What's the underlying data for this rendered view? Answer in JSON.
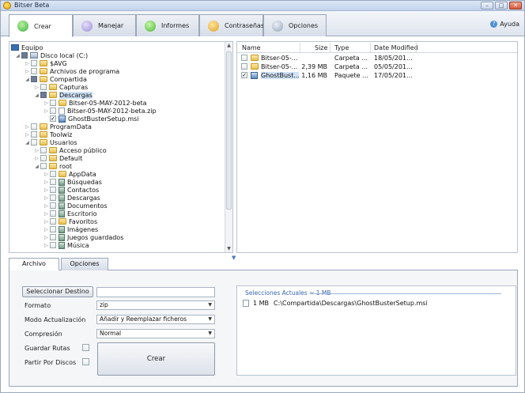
{
  "app": {
    "title": "Bitser Beta"
  },
  "window_controls": {
    "minimize": "–",
    "restore": "□",
    "close": "✕"
  },
  "tabs": [
    {
      "label": "Crear",
      "icon": "create-icon",
      "color": "#3cb043"
    },
    {
      "label": "Manejar",
      "icon": "manage-icon",
      "color": "#9a8fd8"
    },
    {
      "label": "Informes",
      "icon": "reports-icon",
      "color": "#46b83a"
    },
    {
      "label": "Contraseñas",
      "icon": "passwords-icon",
      "color": "#e0a020"
    },
    {
      "label": "Opciones",
      "icon": "options-icon",
      "color": "#8fa0b8"
    }
  ],
  "help": {
    "label": "Ayuda",
    "icon": "help-icon"
  },
  "tree": [
    {
      "label": "Equipo",
      "icon": "computer-icon",
      "arrow": "",
      "check": "none"
    },
    {
      "label": "Disco local (C:)",
      "icon": "drive-icon",
      "arrow": "◢",
      "check": "part"
    },
    {
      "label": "$AVG",
      "icon": "folder-icon",
      "arrow": "▷",
      "check": "off"
    },
    {
      "label": "Archivos de programa",
      "icon": "folder-icon",
      "arrow": "▷",
      "check": "off"
    },
    {
      "label": "Compartida",
      "icon": "folder-icon",
      "arrow": "◢",
      "check": "part"
    },
    {
      "label": "Capturas",
      "icon": "folder-icon",
      "arrow": "▷",
      "check": "off"
    },
    {
      "label": "Descargas",
      "icon": "folder-icon",
      "arrow": "◢",
      "check": "part",
      "selected": true
    },
    {
      "label": "Bitser-05-MAY-2012-beta",
      "icon": "folder-icon",
      "arrow": "▷",
      "check": "off"
    },
    {
      "label": "Bitser-05-MAY-2012-beta.zip",
      "icon": "file-icon",
      "arrow": "▷",
      "check": "off"
    },
    {
      "label": "GhostBusterSetup.msi",
      "icon": "msi-icon",
      "arrow": "",
      "check": "on"
    },
    {
      "label": "ProgramData",
      "icon": "folder-icon",
      "arrow": "▷",
      "check": "off"
    },
    {
      "label": "Toolwiz",
      "icon": "folder-icon",
      "arrow": "▷",
      "check": "off"
    },
    {
      "label": "Usuarios",
      "icon": "folder-icon",
      "arrow": "◢",
      "check": "off"
    },
    {
      "label": "Acceso público",
      "icon": "folder-icon",
      "arrow": "▷",
      "check": "off"
    },
    {
      "label": "Default",
      "icon": "folder-icon",
      "arrow": "▷",
      "check": "off"
    },
    {
      "label": "root",
      "icon": "folder-icon",
      "arrow": "◢",
      "check": "off"
    },
    {
      "label": "AppData",
      "icon": "folder-icon",
      "arrow": "▷",
      "check": "off"
    },
    {
      "label": "Búsquedas",
      "icon": "search-folder-icon",
      "arrow": "▷",
      "check": "off"
    },
    {
      "label": "Contactos",
      "icon": "library-icon",
      "arrow": "▷",
      "check": "off"
    },
    {
      "label": "Descargas",
      "icon": "library-icon",
      "arrow": "▷",
      "check": "off"
    },
    {
      "label": "Documentos",
      "icon": "library-icon",
      "arrow": "▷",
      "check": "off"
    },
    {
      "label": "Escritorio",
      "icon": "library-icon",
      "arrow": "▷",
      "check": "off"
    },
    {
      "label": "Favoritos",
      "icon": "favorites-icon",
      "arrow": "▷",
      "check": "off"
    },
    {
      "label": "Imágenes",
      "icon": "library-icon",
      "arrow": "▷",
      "check": "off"
    },
    {
      "label": "Juegos guardados",
      "icon": "library-icon",
      "arrow": "▷",
      "check": "off"
    },
    {
      "label": "Música",
      "icon": "library-icon",
      "arrow": "▷",
      "check": "off"
    }
  ],
  "file_list": {
    "columns": [
      "Name",
      "Size",
      "Type",
      "Date Modified"
    ],
    "rows": [
      {
        "name": "Bitser-05-...",
        "size": "",
        "type": "Carpeta ...",
        "date": "18/05/201...",
        "checked": false,
        "icon": "folder-icon"
      },
      {
        "name": "Bitser-05-...",
        "size": "2,39 MB",
        "type": "Carpeta ...",
        "date": "05/05/201...",
        "checked": false,
        "icon": "folder-icon"
      },
      {
        "name": "GhostBust...",
        "size": "1,16 MB",
        "type": "Paquete ...",
        "date": "17/05/201...",
        "checked": true,
        "icon": "msi-icon",
        "selected": true
      }
    ]
  },
  "bottom_tabs": [
    {
      "label": "Archivo"
    },
    {
      "label": "Opciones"
    }
  ],
  "form": {
    "destination_button": "Seleccionar Destino",
    "destination_value": "",
    "format_label": "Formato",
    "format_value": "zip",
    "update_mode_label": "Modo Actualización",
    "update_mode_value": "Añadir y Reemplazar ficheros",
    "compression_label": "Compresión",
    "compression_value": "Normal",
    "save_paths_label": "Guardar Rutas",
    "split_label": "Partir Por Discos",
    "create_button": "Crear"
  },
  "selections": {
    "title": "Selecciones Actuales ≈ 1 MB",
    "items": [
      {
        "size": "1 MB",
        "path": "C:\\Compartida\\Descargas\\GhostBusterSetup.msi"
      }
    ]
  }
}
